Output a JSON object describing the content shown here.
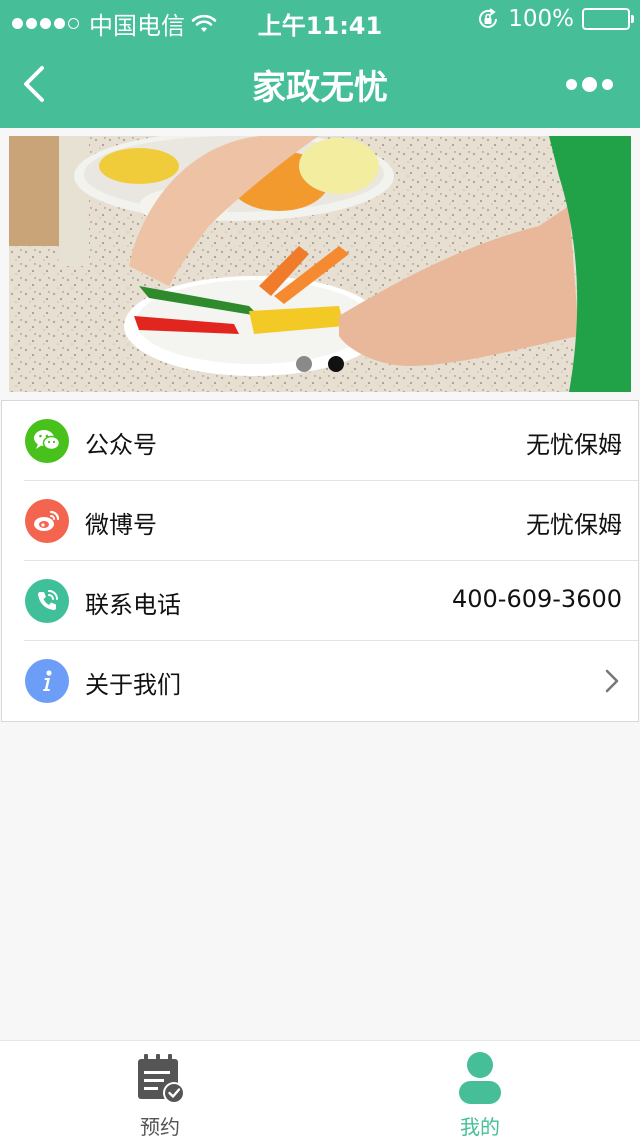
{
  "status_bar": {
    "carrier": "中国电信",
    "time": "上午11:41",
    "battery": "100%"
  },
  "nav": {
    "title": "家政无忧"
  },
  "banner": {
    "slides": 2,
    "active_slide": 2,
    "dot_colors": {
      "active": "#111111",
      "inactive": "#8a8a8a"
    }
  },
  "list": {
    "items": [
      {
        "label": "公众号",
        "value": "无忧保姆",
        "icon": "wechat-icon",
        "color": "#48c11d"
      },
      {
        "label": "微博号",
        "value": "无忧保姆",
        "icon": "weibo-icon",
        "color": "#f3654f"
      },
      {
        "label": "联系电话",
        "value": "400-609-3600",
        "icon": "phone-icon",
        "color": "#3fbf9a"
      },
      {
        "label": "关于我们",
        "value": "",
        "icon": "info-icon",
        "color": "#6c9ef8"
      }
    ]
  },
  "tabbar": {
    "tabs": [
      {
        "label": "预约",
        "icon": "calendar-check-icon",
        "active": false
      },
      {
        "label": "我的",
        "icon": "user-icon",
        "active": true
      }
    ],
    "active_color": "#46bf98",
    "inactive_color": "#555555"
  },
  "colors": {
    "brand": "#46bf98",
    "background": "#f7f7f7"
  }
}
